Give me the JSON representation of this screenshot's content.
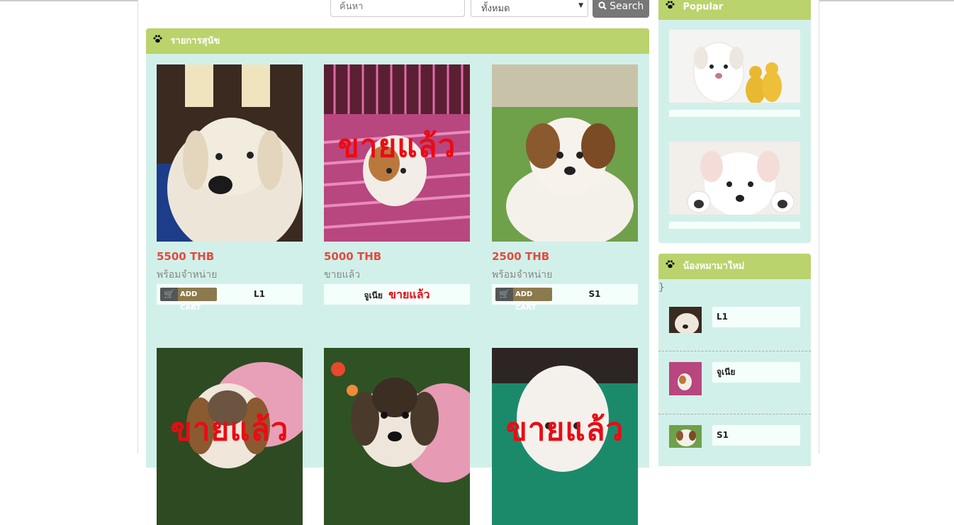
{
  "search": {
    "placeholder": "ค้นหา",
    "category": "ทั้งหมด",
    "button_label": "Search"
  },
  "main_panel": {
    "title": "รายการสุนัข"
  },
  "sold_overlay": "ขายแล้ว",
  "add_cart_label": "ADD CART",
  "products": [
    {
      "price": "5500 THB",
      "status": "พร้อมจำหน่าย",
      "code": "L1",
      "sold": false
    },
    {
      "price": "5000 THB",
      "status": "ขายแล้ว",
      "code": "จูเนีย",
      "sold": true
    },
    {
      "price": "2500 THB",
      "status": "พร้อมจำหน่าย",
      "code": "S1",
      "sold": false
    }
  ],
  "sidebar": {
    "popular_title": "Popular",
    "new_title": "น้องหมามาใหม่",
    "brace": "}",
    "new_items": [
      {
        "label": "L1"
      },
      {
        "label": "จูเนีย"
      },
      {
        "label": "S1"
      }
    ]
  },
  "colors": {
    "panel_bg": "#d2f0ea",
    "header_green": "#bad36c",
    "price_red": "#e34a3e",
    "sold_red": "#ea0b14"
  }
}
